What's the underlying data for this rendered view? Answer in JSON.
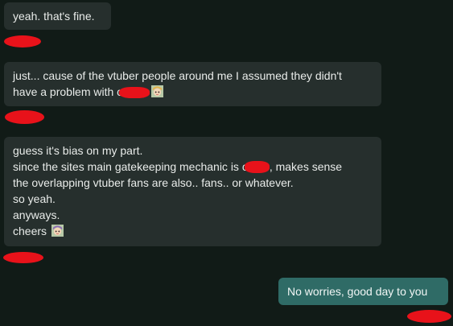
{
  "messages": [
    {
      "id": "m1",
      "direction": "incoming",
      "lines": [
        "yeah. that's fine."
      ]
    },
    {
      "id": "m2",
      "direction": "incoming",
      "lines": [
        "just... cause of the vtuber people around me I assumed they didn't",
        "have a problem with c"
      ]
    },
    {
      "id": "m3",
      "direction": "incoming",
      "lines": [
        "guess it's bias on my part.",
        "since the sites main gatekeeping mechanic is c",
        ", makes sense",
        "the overlapping vtuber fans are also.. fans.. or whatever.",
        "so yeah.",
        "anyways.",
        "cheers"
      ]
    },
    {
      "id": "m4",
      "direction": "outgoing",
      "lines": [
        "No worries, good day to you"
      ]
    }
  ],
  "colors": {
    "background": "#111b17",
    "incoming_bubble": "#262f2d",
    "outgoing_bubble": "#2f6b66",
    "redaction": "#e8121a"
  },
  "icons": [
    "anime-girl-emoji-icon"
  ]
}
